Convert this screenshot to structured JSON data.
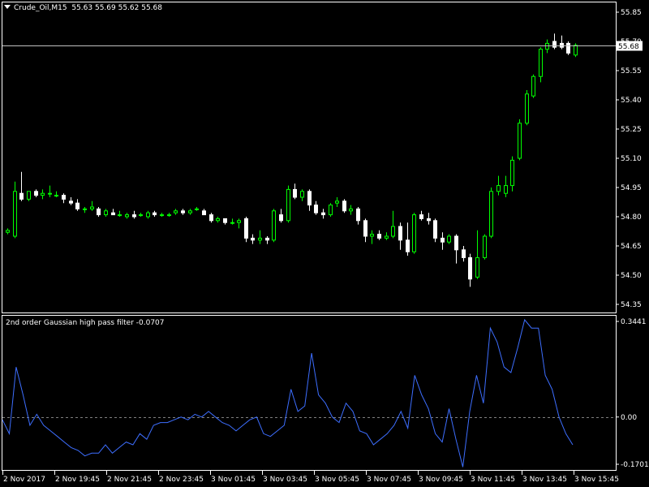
{
  "header": {
    "symbol": "Crude_Oil,M15",
    "ohlc": "55.63 55.69 55.62 55.68"
  },
  "indicator": {
    "label": "2nd order Gaussian high pass filter -0.0707"
  },
  "colors": {
    "background": "#000000",
    "bull_candle": "#00ff00",
    "bull_body": "#000000",
    "bear_candle": "#ffffff",
    "indicator_line": "#3d6eff",
    "axis": "#ffffff",
    "bid_line": "#c0c0c0",
    "zero_line": "#808080"
  },
  "chart_data": [
    {
      "type": "candlestick",
      "title": "Crude_Oil,M15",
      "y_ticks": [
        "55.85",
        "55.70",
        "55.55",
        "55.40",
        "55.25",
        "55.10",
        "54.95",
        "54.80",
        "54.65",
        "54.50",
        "54.35"
      ],
      "ylim": [
        54.35,
        55.85
      ],
      "current_price": "55.68",
      "x_ticks": [
        "2 Nov 2017",
        "2 Nov 19:45",
        "2 Nov 21:45",
        "2 Nov 23:45",
        "3 Nov 01:45",
        "3 Nov 03:45",
        "3 Nov 05:45",
        "3 Nov 07:45",
        "3 Nov 09:45",
        "3 Nov 11:45",
        "3 Nov 13:45",
        "3 Nov 15:45"
      ],
      "candles": [
        {
          "o": 54.72,
          "h": 54.74,
          "l": 54.71,
          "c": 54.73
        },
        {
          "o": 54.7,
          "h": 54.98,
          "l": 54.69,
          "c": 54.93
        },
        {
          "o": 54.92,
          "h": 55.03,
          "l": 54.88,
          "c": 54.89
        },
        {
          "o": 54.89,
          "h": 54.93,
          "l": 54.88,
          "c": 54.93
        },
        {
          "o": 54.93,
          "h": 54.94,
          "l": 54.9,
          "c": 54.91
        },
        {
          "o": 54.91,
          "h": 54.94,
          "l": 54.89,
          "c": 54.92
        },
        {
          "o": 54.92,
          "h": 54.96,
          "l": 54.9,
          "c": 54.92
        },
        {
          "o": 54.91,
          "h": 54.93,
          "l": 54.9,
          "c": 54.91
        },
        {
          "o": 54.91,
          "h": 54.92,
          "l": 54.87,
          "c": 54.89
        },
        {
          "o": 54.88,
          "h": 54.9,
          "l": 54.86,
          "c": 54.87
        },
        {
          "o": 54.87,
          "h": 54.89,
          "l": 54.83,
          "c": 54.84
        },
        {
          "o": 54.84,
          "h": 54.85,
          "l": 54.82,
          "c": 54.84
        },
        {
          "o": 54.84,
          "h": 54.88,
          "l": 54.83,
          "c": 54.85
        },
        {
          "o": 54.84,
          "h": 54.85,
          "l": 54.8,
          "c": 54.81
        },
        {
          "o": 54.81,
          "h": 54.84,
          "l": 54.8,
          "c": 54.83
        },
        {
          "o": 54.82,
          "h": 54.84,
          "l": 54.81,
          "c": 54.81
        },
        {
          "o": 54.81,
          "h": 54.83,
          "l": 54.8,
          "c": 54.81
        },
        {
          "o": 54.8,
          "h": 54.82,
          "l": 54.79,
          "c": 54.81
        },
        {
          "o": 54.81,
          "h": 54.83,
          "l": 54.79,
          "c": 54.8
        },
        {
          "o": 54.81,
          "h": 54.82,
          "l": 54.8,
          "c": 54.81
        },
        {
          "o": 54.8,
          "h": 54.83,
          "l": 54.79,
          "c": 54.82
        },
        {
          "o": 54.82,
          "h": 54.83,
          "l": 54.8,
          "c": 54.81
        },
        {
          "o": 54.81,
          "h": 54.82,
          "l": 54.8,
          "c": 54.81
        },
        {
          "o": 54.81,
          "h": 54.82,
          "l": 54.8,
          "c": 54.81
        },
        {
          "o": 54.82,
          "h": 54.84,
          "l": 54.81,
          "c": 54.83
        },
        {
          "o": 54.83,
          "h": 54.84,
          "l": 54.81,
          "c": 54.82
        },
        {
          "o": 54.82,
          "h": 54.84,
          "l": 54.81,
          "c": 54.83
        },
        {
          "o": 54.84,
          "h": 54.85,
          "l": 54.83,
          "c": 54.84
        },
        {
          "o": 54.83,
          "h": 54.84,
          "l": 54.81,
          "c": 54.81
        },
        {
          "o": 54.81,
          "h": 54.82,
          "l": 54.77,
          "c": 54.78
        },
        {
          "o": 54.78,
          "h": 54.8,
          "l": 54.77,
          "c": 54.79
        },
        {
          "o": 54.79,
          "h": 54.79,
          "l": 54.76,
          "c": 54.77
        },
        {
          "o": 54.77,
          "h": 54.79,
          "l": 54.76,
          "c": 54.77
        },
        {
          "o": 54.77,
          "h": 54.79,
          "l": 54.74,
          "c": 54.78
        },
        {
          "o": 54.79,
          "h": 54.8,
          "l": 54.67,
          "c": 54.69
        },
        {
          "o": 54.69,
          "h": 54.71,
          "l": 54.66,
          "c": 54.68
        },
        {
          "o": 54.68,
          "h": 54.73,
          "l": 54.66,
          "c": 54.69
        },
        {
          "o": 54.69,
          "h": 54.7,
          "l": 54.66,
          "c": 54.68
        },
        {
          "o": 54.68,
          "h": 54.84,
          "l": 54.67,
          "c": 54.83
        },
        {
          "o": 54.81,
          "h": 54.84,
          "l": 54.77,
          "c": 54.78
        },
        {
          "o": 54.78,
          "h": 54.96,
          "l": 54.77,
          "c": 54.94
        },
        {
          "o": 54.94,
          "h": 54.97,
          "l": 54.89,
          "c": 54.9
        },
        {
          "o": 54.9,
          "h": 54.94,
          "l": 54.88,
          "c": 54.93
        },
        {
          "o": 54.93,
          "h": 54.94,
          "l": 54.83,
          "c": 54.86
        },
        {
          "o": 54.86,
          "h": 54.88,
          "l": 54.81,
          "c": 54.82
        },
        {
          "o": 54.82,
          "h": 54.84,
          "l": 54.79,
          "c": 54.81
        },
        {
          "o": 54.81,
          "h": 54.87,
          "l": 54.8,
          "c": 54.86
        },
        {
          "o": 54.87,
          "h": 54.9,
          "l": 54.85,
          "c": 54.88
        },
        {
          "o": 54.88,
          "h": 54.89,
          "l": 54.82,
          "c": 54.83
        },
        {
          "o": 54.83,
          "h": 54.86,
          "l": 54.81,
          "c": 54.84
        },
        {
          "o": 54.84,
          "h": 54.85,
          "l": 54.76,
          "c": 54.78
        },
        {
          "o": 54.78,
          "h": 54.79,
          "l": 54.67,
          "c": 54.7
        },
        {
          "o": 54.7,
          "h": 54.73,
          "l": 54.66,
          "c": 54.71
        },
        {
          "o": 54.71,
          "h": 54.73,
          "l": 54.68,
          "c": 54.69
        },
        {
          "o": 54.69,
          "h": 54.72,
          "l": 54.68,
          "c": 54.7
        },
        {
          "o": 54.7,
          "h": 54.83,
          "l": 54.69,
          "c": 54.75
        },
        {
          "o": 54.75,
          "h": 54.77,
          "l": 54.63,
          "c": 54.68
        },
        {
          "o": 54.68,
          "h": 54.77,
          "l": 54.6,
          "c": 54.62
        },
        {
          "o": 54.62,
          "h": 54.82,
          "l": 54.61,
          "c": 54.81
        },
        {
          "o": 54.81,
          "h": 54.83,
          "l": 54.78,
          "c": 54.79
        },
        {
          "o": 54.79,
          "h": 54.82,
          "l": 54.76,
          "c": 54.78
        },
        {
          "o": 54.78,
          "h": 54.79,
          "l": 54.67,
          "c": 54.69
        },
        {
          "o": 54.69,
          "h": 54.72,
          "l": 54.63,
          "c": 54.67
        },
        {
          "o": 54.67,
          "h": 54.71,
          "l": 54.66,
          "c": 54.7
        },
        {
          "o": 54.7,
          "h": 54.71,
          "l": 54.56,
          "c": 54.63
        },
        {
          "o": 54.63,
          "h": 54.65,
          "l": 54.57,
          "c": 54.59
        },
        {
          "o": 54.59,
          "h": 54.61,
          "l": 54.44,
          "c": 54.48
        },
        {
          "o": 54.49,
          "h": 54.73,
          "l": 54.48,
          "c": 54.59
        },
        {
          "o": 54.59,
          "h": 54.71,
          "l": 54.58,
          "c": 54.7
        },
        {
          "o": 54.7,
          "h": 54.95,
          "l": 54.69,
          "c": 54.93
        },
        {
          "o": 54.93,
          "h": 55.01,
          "l": 54.91,
          "c": 54.96
        },
        {
          "o": 54.92,
          "h": 55.01,
          "l": 54.9,
          "c": 54.96
        },
        {
          "o": 54.96,
          "h": 55.11,
          "l": 54.93,
          "c": 55.09
        },
        {
          "o": 55.1,
          "h": 55.3,
          "l": 55.09,
          "c": 55.28
        },
        {
          "o": 55.28,
          "h": 55.45,
          "l": 55.27,
          "c": 55.43
        },
        {
          "o": 55.42,
          "h": 55.53,
          "l": 55.41,
          "c": 55.52
        },
        {
          "o": 55.52,
          "h": 55.67,
          "l": 55.49,
          "c": 55.66
        },
        {
          "o": 55.66,
          "h": 55.71,
          "l": 55.64,
          "c": 55.69
        },
        {
          "o": 55.7,
          "h": 55.74,
          "l": 55.66,
          "c": 55.67
        },
        {
          "o": 55.69,
          "h": 55.73,
          "l": 55.66,
          "c": 55.67
        },
        {
          "o": 55.69,
          "h": 55.7,
          "l": 55.63,
          "c": 55.64
        },
        {
          "o": 55.63,
          "h": 55.69,
          "l": 55.62,
          "c": 55.68
        }
      ]
    },
    {
      "type": "line",
      "title": "2nd order Gaussian high pass filter -0.0707",
      "y_ticks": [
        "0.3441",
        "0.00",
        "-0.1701"
      ],
      "ylim": [
        -0.1701,
        0.3441
      ],
      "series": [
        {
          "values": [
            -0.01,
            -0.06,
            0.18,
            0.08,
            -0.03,
            0.01,
            -0.03,
            -0.05,
            -0.07,
            -0.09,
            -0.11,
            -0.12,
            -0.14,
            -0.13,
            -0.13,
            -0.1,
            -0.13,
            -0.11,
            -0.09,
            -0.1,
            -0.06,
            -0.08,
            -0.03,
            -0.02,
            -0.02,
            -0.01,
            0.0,
            -0.01,
            0.01,
            0.0,
            0.02,
            0.0,
            -0.02,
            -0.03,
            -0.05,
            -0.03,
            -0.01,
            0.0,
            -0.06,
            -0.07,
            -0.05,
            -0.03,
            0.1,
            0.02,
            0.04,
            0.23,
            0.08,
            0.05,
            0.0,
            -0.02,
            0.05,
            0.02,
            -0.05,
            -0.06,
            -0.1,
            -0.08,
            -0.06,
            -0.03,
            0.02,
            -0.04,
            0.15,
            0.08,
            0.03,
            -0.06,
            -0.09,
            0.03,
            -0.08,
            -0.18,
            0.02,
            0.15,
            0.05,
            0.32,
            0.27,
            0.18,
            0.16,
            0.25,
            0.35,
            0.32,
            0.32,
            0.15,
            0.1,
            0.0,
            -0.06,
            -0.1
          ]
        }
      ]
    }
  ]
}
